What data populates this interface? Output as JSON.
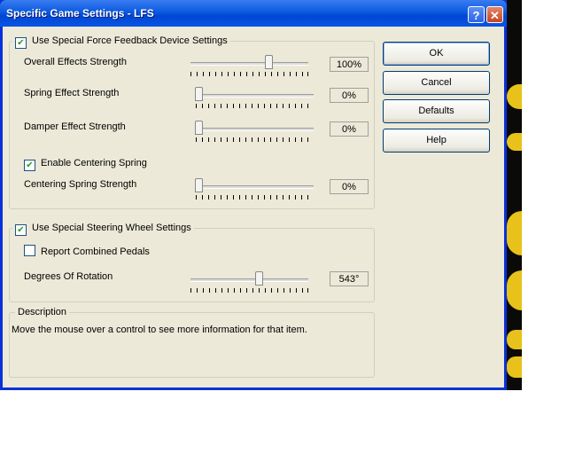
{
  "window": {
    "title": "Specific Game Settings - LFS"
  },
  "titlebar": {
    "help_glyph": "?",
    "close_glyph": "✕"
  },
  "force_feedback": {
    "label": "Use Special Force Feedback Device Settings",
    "checked": true,
    "overall": {
      "label": "Overall Effects Strength",
      "value": "100%",
      "level": 1.0
    },
    "spring": {
      "label": "Spring Effect Strength",
      "value": "0%",
      "level": 0.0
    },
    "damper": {
      "label": "Damper Effect Strength",
      "value": "0%",
      "level": 0.0
    },
    "centering_enable": {
      "label": "Enable Centering Spring",
      "checked": true
    },
    "centering": {
      "label": "Centering Spring Strength",
      "value": "0%",
      "level": 0.0
    }
  },
  "steering": {
    "label": "Use Special Steering Wheel Settings",
    "checked": true,
    "combined": {
      "label": "Report Combined Pedals",
      "checked": false
    },
    "rotation": {
      "label": "Degrees Of Rotation",
      "value": "543°"
    }
  },
  "description": {
    "title": "Description",
    "text": "Move the mouse over a control to see more information for that item."
  },
  "buttons": {
    "ok": "OK",
    "cancel": "Cancel",
    "defaults": "Defaults",
    "help": "Help"
  },
  "check_glyph": "✔"
}
